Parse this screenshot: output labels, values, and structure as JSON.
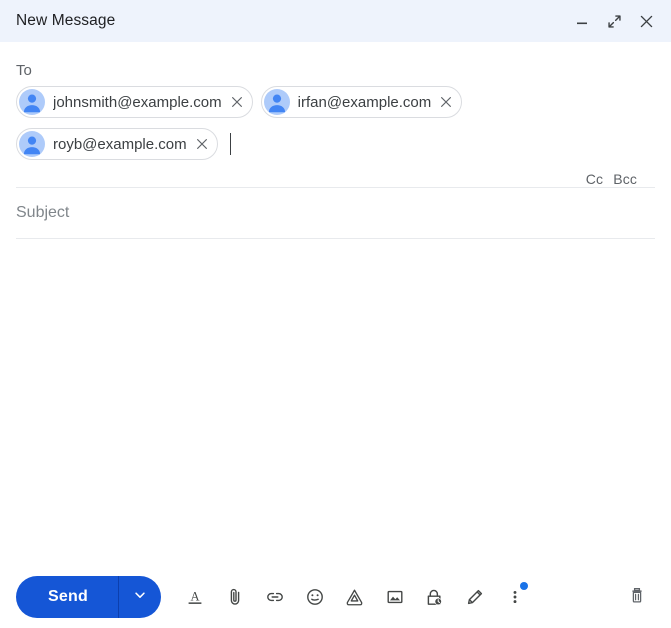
{
  "window": {
    "title": "New Message",
    "controls": [
      {
        "name": "minimize-button",
        "icon": "minimize-icon",
        "label": "–"
      },
      {
        "name": "expand-button",
        "icon": "expand-icon",
        "label": "↗"
      },
      {
        "name": "close-button",
        "icon": "close-icon",
        "label": "✕"
      }
    ],
    "header_bg": "#eef3fc"
  },
  "recipients": {
    "to_label": "To",
    "chips": [
      {
        "email": "johnsmith@example.com",
        "avatar_icon": "person-avatar-icon",
        "remove_icon": "close-icon"
      },
      {
        "email": "irfan@example.com",
        "avatar_icon": "person-avatar-icon",
        "remove_icon": "close-icon"
      },
      {
        "email": "royb@example.com",
        "avatar_icon": "person-avatar-icon",
        "remove_icon": "close-icon"
      }
    ],
    "cc_label": "Cc",
    "bcc_label": "Bcc",
    "caret_visible": true
  },
  "subject": {
    "value": "",
    "placeholder": "Subject"
  },
  "body": {
    "value": "",
    "placeholder": ""
  },
  "toolbar": {
    "send_label": "Send",
    "send_color": "#1556d6",
    "send_dropdown_icon": "chevron-down-icon",
    "icons": [
      {
        "name": "formatting-options-button",
        "icon": "format-text-icon",
        "title": "Formatting options"
      },
      {
        "name": "attach-files-button",
        "icon": "paperclip-icon",
        "title": "Attach files"
      },
      {
        "name": "insert-link-button",
        "icon": "link-icon",
        "title": "Insert link"
      },
      {
        "name": "insert-emoji-button",
        "icon": "emoji-icon",
        "title": "Insert emoji"
      },
      {
        "name": "insert-drive-file-button",
        "icon": "google-drive-icon",
        "title": "Insert files using Drive"
      },
      {
        "name": "insert-photo-button",
        "icon": "image-icon",
        "title": "Insert photo"
      },
      {
        "name": "confidential-mode-button",
        "icon": "lock-clock-icon",
        "title": "Toggle confidential mode"
      },
      {
        "name": "insert-signature-button",
        "icon": "pen-icon",
        "title": "Insert signature"
      },
      {
        "name": "more-options-button",
        "icon": "three-dots-vertical-icon",
        "title": "More options",
        "badge": true
      }
    ],
    "badge_color": "#1a73e8",
    "discard": {
      "name": "discard-draft-button",
      "icon": "trash-icon",
      "title": "Discard draft"
    }
  }
}
